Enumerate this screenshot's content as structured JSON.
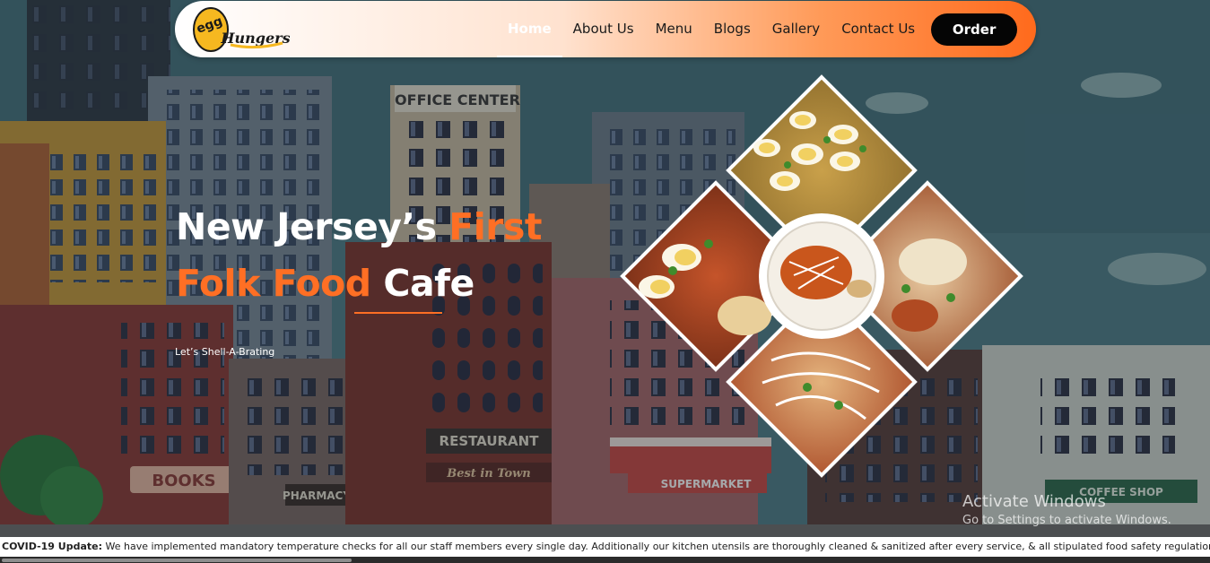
{
  "brand": {
    "logo_text": "egg",
    "logo_script": "Hungers",
    "accent": "#ff6f24"
  },
  "nav": {
    "items": [
      {
        "label": "Home",
        "active": true
      },
      {
        "label": "About Us",
        "active": false
      },
      {
        "label": "Menu",
        "active": false
      },
      {
        "label": "Blogs",
        "active": false
      },
      {
        "label": "Gallery",
        "active": false
      },
      {
        "label": "Contact Us",
        "active": false
      }
    ],
    "order_label": "Order"
  },
  "hero": {
    "line1_white": "New Jersey’s ",
    "line1_orange": "First",
    "line2_orange": "Folk Food ",
    "line2_white": "Cafe",
    "tagline": "Let’s Shell-A-Brating"
  },
  "city_signs": {
    "office": "OFFICE CENTER",
    "restaurant": "RESTAURANT",
    "best": "Best in Town",
    "books": "BOOKS",
    "pharmacy": "PHARMACY",
    "supermarket": "SUPERMARKET",
    "coffee": "COFFEE SHOP"
  },
  "collage_dishes": [
    "egg-biryani-icon",
    "egg-curry-icon",
    "egg-omelette-icon",
    "egg-gravy-icon",
    "egg-noodles-icon"
  ],
  "watermark": {
    "title": "Activate Windows",
    "subtitle": "Go to Settings to activate Windows."
  },
  "ticker": {
    "prefix": "COVID-19 Update:",
    "text": " We have implemented mandatory temperature checks for all our staff members every single day. Additionally our kitchen utensils are thoroughly cleaned & sanitized after every service, & all stipulated food safety regulations are"
  }
}
